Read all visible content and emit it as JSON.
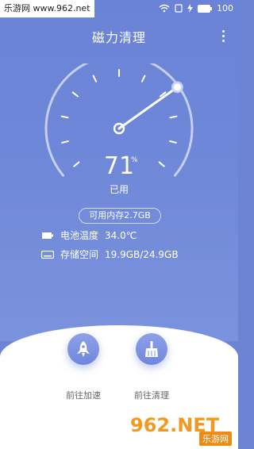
{
  "status_bar": {
    "watermark": "乐游网 www.962.net",
    "battery": "100"
  },
  "header": {
    "title": "磁力清理",
    "more_icon": "more-vertical-icon"
  },
  "gauge": {
    "value": "71",
    "unit": "%",
    "label": "已用",
    "usage_fraction": 0.71
  },
  "memory": {
    "available": "可用内存2.7GB"
  },
  "info": {
    "battery_temp_label": "电池温度",
    "battery_temp_value": "34.0℃",
    "storage_label": "存储空间",
    "storage_value": "19.9GB/24.9GB"
  },
  "actions": [
    {
      "label": "前往加速",
      "icon": "rocket-icon"
    },
    {
      "label": "前往清理",
      "icon": "broom-icon"
    }
  ],
  "watermark_bottom": {
    "big": "962.NET",
    "small": "乐游网"
  },
  "colors": {
    "primary": "#6d84d4",
    "white": "#ffffff",
    "watermark_orange": "#f29a1f"
  }
}
